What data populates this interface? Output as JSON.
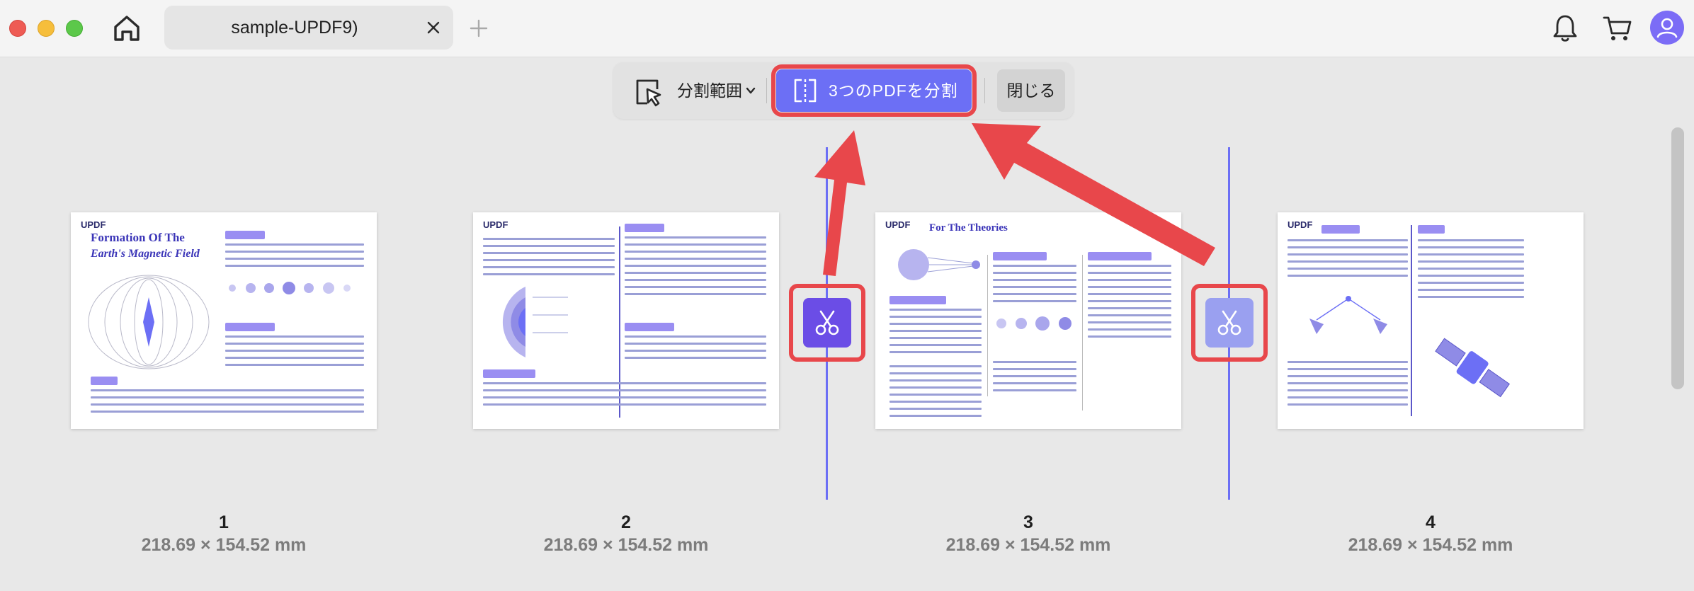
{
  "window": {
    "tab_title": "sample-UPDF9)"
  },
  "toolbar": {
    "range_label": "分割範囲",
    "split_label": "3つのPDFを分割",
    "close_label": "閉じる"
  },
  "pages": [
    {
      "number": "1",
      "size": "218.69 × 154.52 mm",
      "logo": "UPDF",
      "title_line1": "Formation Of The",
      "title_line2": "Earth's Magnetic Field"
    },
    {
      "number": "2",
      "size": "218.69 × 154.52 mm",
      "logo": "UPDF"
    },
    {
      "number": "3",
      "size": "218.69 × 154.52 mm",
      "logo": "UPDF",
      "title_line1": "For The Theories"
    },
    {
      "number": "4",
      "size": "218.69 × 154.52 mm",
      "logo": "UPDF"
    }
  ],
  "icons": [
    "home-icon",
    "close-icon",
    "plus-icon",
    "bell-icon",
    "cart-icon",
    "user-icon",
    "cursor-select-icon",
    "chevron-down-icon",
    "split-document-icon",
    "scissors-icon"
  ],
  "colors": {
    "accent": "#6c6ff5",
    "scissor_active": "#6b4de6",
    "scissor_inactive": "#9aa0f0",
    "highlight_red": "#e8474b",
    "avatar": "#7b6cf6"
  }
}
